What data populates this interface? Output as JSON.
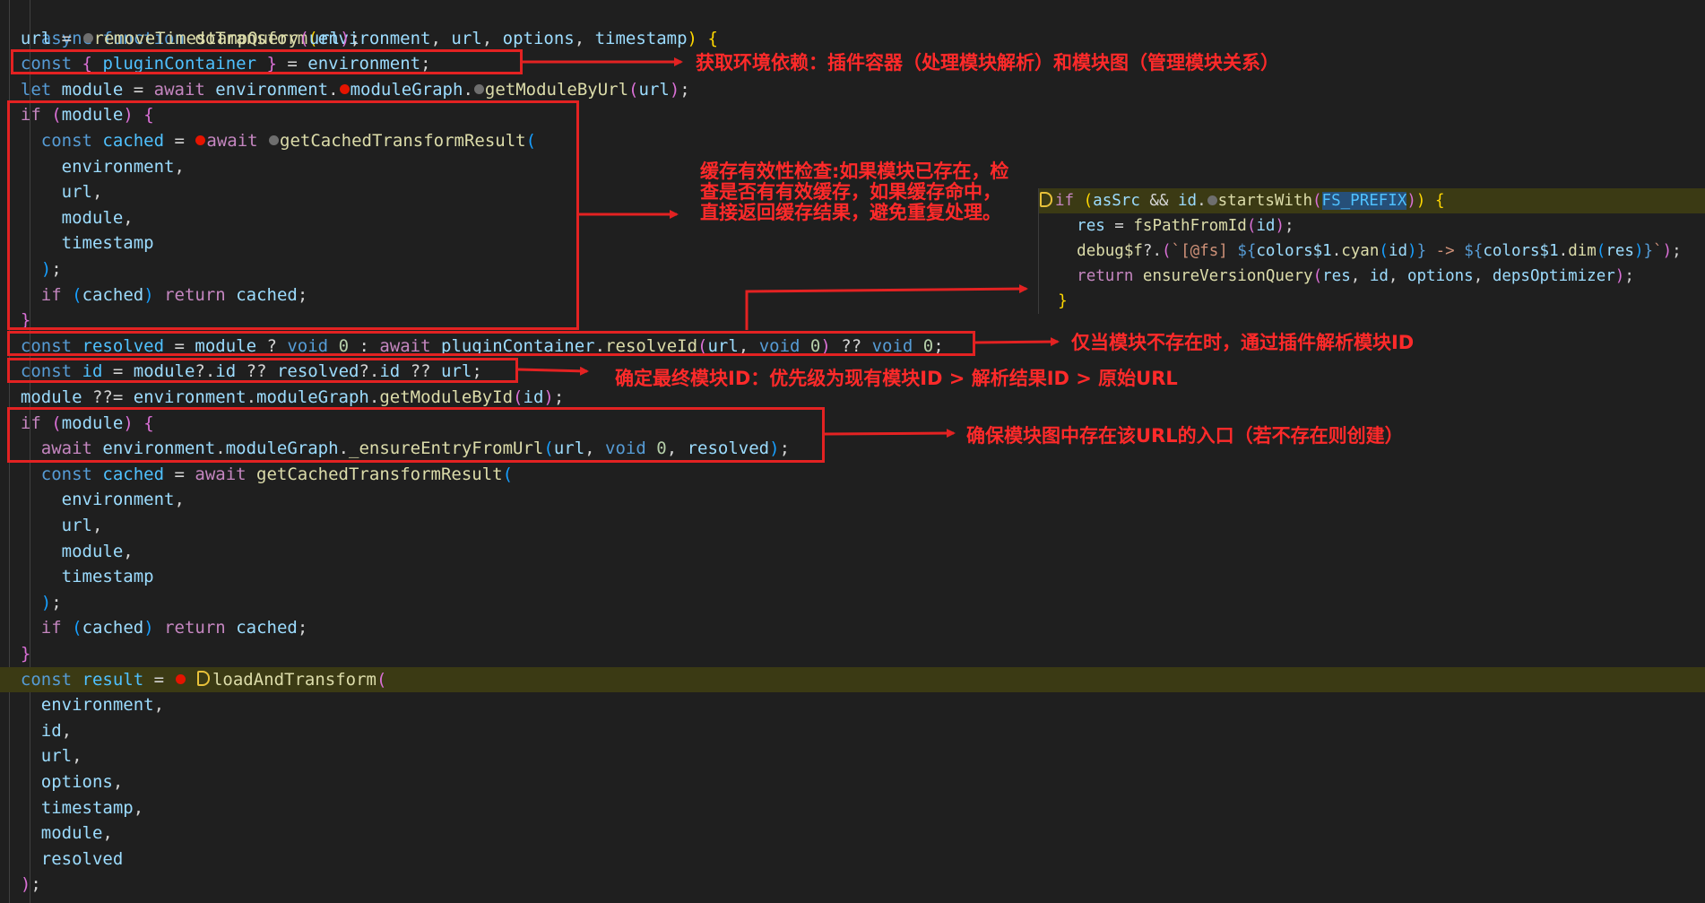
{
  "editor": {
    "lines": [
      "async function doTransform(environment, url, options, timestamp) {",
      "  url = removeTimestampQuery(url);",
      "  const { pluginContainer } = environment;",
      "  let module = await environment.moduleGraph.getModuleByUrl(url);",
      "  if (module) {",
      "    const cached = await getCachedTransformResult(",
      "      environment,",
      "      url,",
      "      module,",
      "      timestamp",
      "    );",
      "    if (cached) return cached;",
      "  }",
      "  const resolved = module ? void 0 : await pluginContainer.resolveId(url, void 0) ?? void 0;",
      "  const id = module?.id ?? resolved?.id ?? url;",
      "  module ??= environment.moduleGraph.getModuleById(id);",
      "  if (module) {",
      "    await environment.moduleGraph._ensureEntryFromUrl(url, void 0, resolved);",
      "    const cached = await getCachedTransformResult(",
      "      environment,",
      "      url,",
      "      module,",
      "      timestamp",
      "    );",
      "    if (cached) return cached;",
      "  }",
      "  const result = loadAndTransform(",
      "    environment,",
      "    id,",
      "    url,",
      "    options,",
      "    timestamp,",
      "    module,",
      "    resolved",
      "  );"
    ]
  },
  "peek": {
    "lines": [
      "if (asSrc && id.startsWith(FS_PREFIX)) {",
      "  res = fsPathFromId(id);",
      "  debug$f?.(`[@fs] ${colors$1.cyan(id)} -> ${colors$1.dim(res)}`);",
      "  return ensureVersionQuery(res, id, options, depsOptimizer);",
      "}"
    ]
  },
  "annotations": {
    "env_deps": "获取环境依赖：插件容器（处理模块解析）和模块图（管理模块关系）",
    "cache_check": "缓存有效性检查:如果模块已存在，检查是否有有效缓存，如果缓存命中，直接返回缓存结果，避免重复处理。",
    "resolve_only": "仅当模块不存在时，通过插件解析模块ID",
    "final_id": "确定最终模块ID：优先级为现有模块ID > 解析结果ID > 原始URL",
    "ensure_entry": "确保模块图中存在该URL的入口（若不存在则创建）"
  },
  "colors": {
    "background": "#1f1f1f",
    "annotation_red": "#e32222",
    "keyword": "#569cd6",
    "control": "#c586c0",
    "function": "#dcdcaa",
    "variable": "#9cdcfe"
  }
}
